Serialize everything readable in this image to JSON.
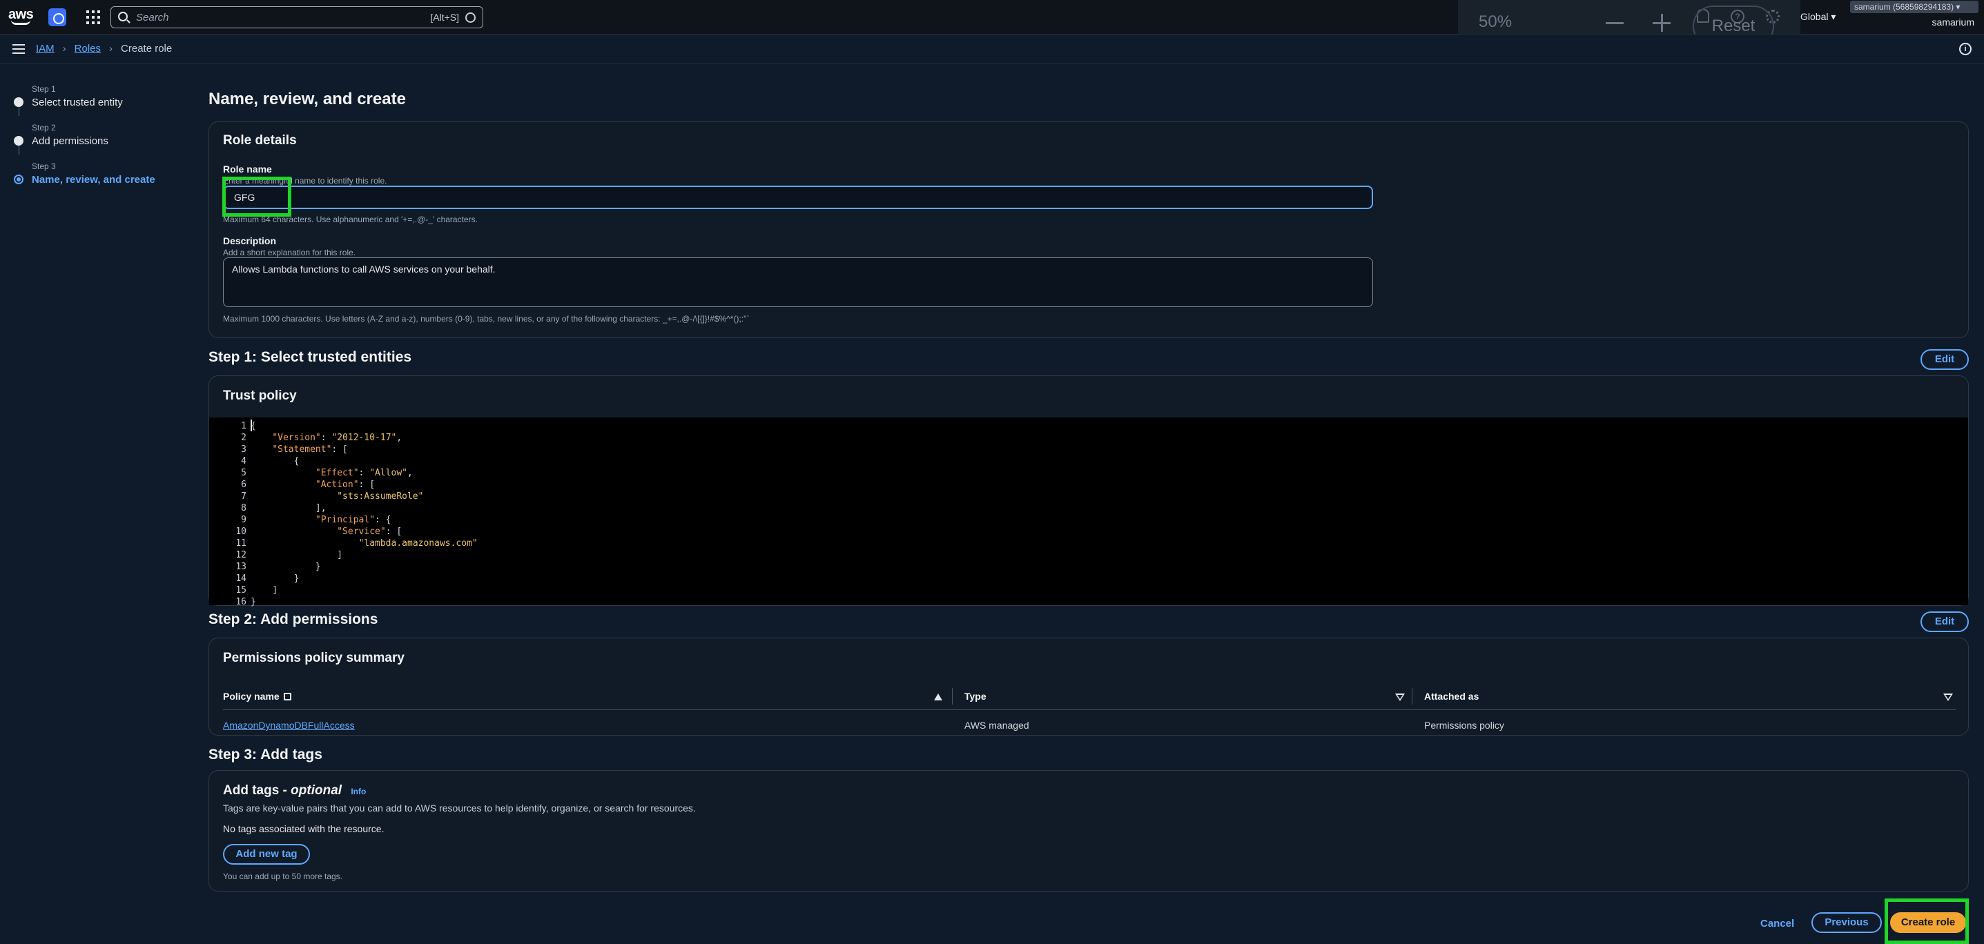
{
  "nav": {
    "search_placeholder": "Search",
    "search_shortcut": "[Alt+S]",
    "region": "Global ▾",
    "account_id": "samarium (568598294183) ▾",
    "account_name": "samarium",
    "zoom": {
      "percent": "50%",
      "reset": "Reset"
    }
  },
  "breadcrumb": {
    "iam": "IAM",
    "roles": "Roles",
    "current": "Create role"
  },
  "steps": [
    {
      "label": "Step 1",
      "title": "Select trusted entity"
    },
    {
      "label": "Step 2",
      "title": "Add permissions"
    },
    {
      "label": "Step 3",
      "title": "Name, review, and create"
    }
  ],
  "page": {
    "title": "Name, review, and create",
    "role_details": {
      "title": "Role details",
      "role_name_label": "Role name",
      "role_name_hint": "Enter a meaningful name to identify this role.",
      "role_name_value": "GFG",
      "role_name_constraint": "Maximum 64 characters. Use alphanumeric and '+=,.@-_' characters.",
      "description_label": "Description",
      "description_hint": "Add a short explanation for this role.",
      "description_value": "Allows Lambda functions to call AWS services on your behalf.",
      "description_constraint": "Maximum 1000 characters. Use letters (A-Z and a-z), numbers (0-9), tabs, new lines, or any of the following characters: _+=,.@-/\\[{]}!#$%^*();:\"`"
    },
    "step1": {
      "heading": "Step 1: Select trusted entities",
      "edit": "Edit",
      "panel_title": "Trust policy",
      "line_numbers": [
        "1",
        "2",
        "3",
        "4",
        "5",
        "6",
        "7",
        "8",
        "9",
        "10",
        "11",
        "12",
        "13",
        "14",
        "15",
        "16"
      ]
    },
    "step2": {
      "heading": "Step 2: Add permissions",
      "edit": "Edit",
      "panel_title": "Permissions policy summary",
      "columns": [
        "Policy name",
        "Type",
        "Attached as"
      ],
      "rows": [
        {
          "policy": "AmazonDynamoDBFullAccess",
          "type": "AWS managed",
          "attached": "Permissions policy"
        }
      ]
    },
    "step3": {
      "heading": "Step 3: Add tags",
      "panel_title": "Add tags - ",
      "optional": "optional",
      "info": "Info",
      "desc": "Tags are key-value pairs that you can add to AWS resources to help identify, organize, or search for resources.",
      "empty": "No tags associated with the resource.",
      "add_button": "Add new tag",
      "limit": "You can add up to 50 more tags."
    },
    "footer": {
      "cancel": "Cancel",
      "previous": "Previous",
      "create": "Create role"
    }
  },
  "colors": {
    "accent": "#5fa8ff",
    "primary": "#f3a531",
    "highlight": "#22d32a",
    "background": "#0f1b2a"
  }
}
